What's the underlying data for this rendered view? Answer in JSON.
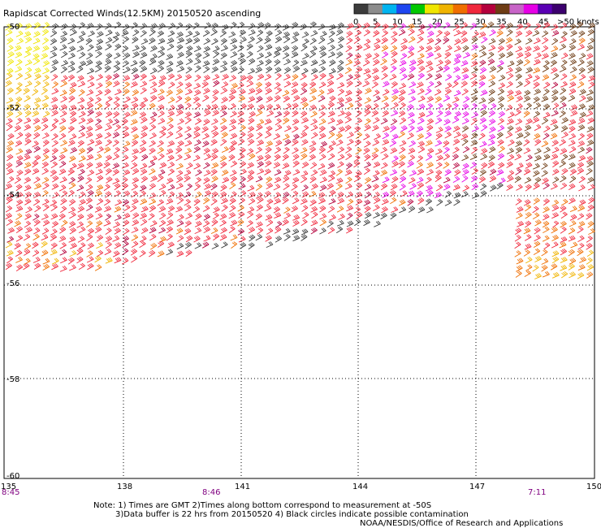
{
  "title": "Rapidscat Corrected Winds(12.5KM) 20150520 ascending",
  "colorbar": {
    "labels": [
      "0",
      "5",
      "10",
      "15",
      "20",
      "25",
      "30",
      "35",
      "40",
      "45",
      ">50 knots"
    ],
    "colors": [
      "#3c3c3c",
      "#8c8c8c",
      "#00b4f0",
      "#1e46f0",
      "#00c800",
      "#f0e600",
      "#f0b400",
      "#f06e00",
      "#f0283c",
      "#b4003c",
      "#6e3c14",
      "#c864c8",
      "#e600e6",
      "#5a00b4",
      "#3c006e"
    ]
  },
  "axes": {
    "lat_labels": [
      "-50",
      "-52",
      "-54",
      "-56",
      "-58",
      "-60"
    ],
    "lon_labels": [
      "135",
      "138",
      "141",
      "144",
      "147",
      "150"
    ]
  },
  "times": [
    "8:45",
    "8:46",
    "7:11"
  ],
  "notes": [
    "Note: 1) Times are GMT 2)Times along bottom correspond to measurement at -50S",
    "3)Data buffer is 22 hrs from 20150520 4) Black circles indicate possible contamination",
    "NOAA/NESDIS/Office of Research and Applications"
  ]
}
